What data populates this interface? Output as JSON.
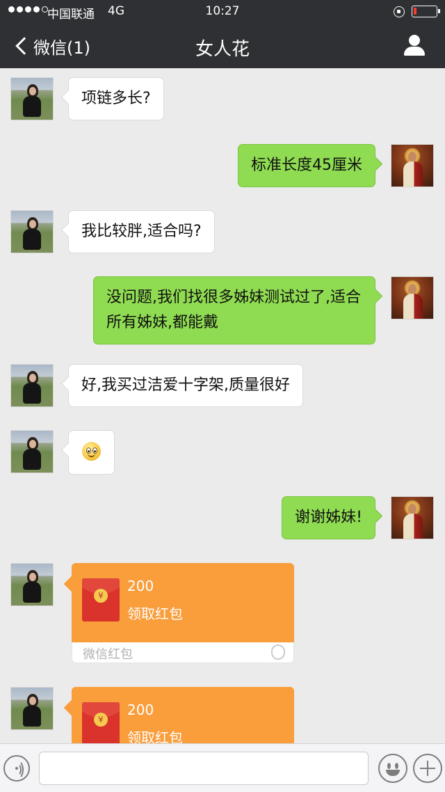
{
  "status_bar": {
    "carrier": "中国联通",
    "network": "4G",
    "time": "10:27"
  },
  "nav": {
    "back_label": "微信(1)",
    "title": "女人花"
  },
  "messages": [
    {
      "side": "left",
      "text": "项链多长?"
    },
    {
      "side": "right",
      "text": "标准长度45厘米"
    },
    {
      "side": "left",
      "text": "我比较胖,适合吗?"
    },
    {
      "side": "right",
      "text": "没问题,我们找很多姊妹测试过了,适合所有姊妹,都能戴"
    },
    {
      "side": "left",
      "text": "好,我买过洁爱十字架,质量很好"
    },
    {
      "side": "left",
      "emoji": "smile-emoji"
    },
    {
      "side": "right",
      "text": "谢谢姊妹!"
    }
  ],
  "red_packets": [
    {
      "amount": "200",
      "action": "领取红包",
      "source": "微信红包"
    },
    {
      "amount": "200",
      "action": "领取红包"
    }
  ],
  "input_bar": {
    "placeholder": ""
  },
  "colors": {
    "nav_bg": "#2e3033",
    "bubble_green": "#8fdc52",
    "bubble_white": "#ffffff",
    "red_packet": "#fa9d3b",
    "chat_bg": "#ebebeb"
  },
  "icons": [
    "back-chevron-icon",
    "profile-icon",
    "voice-icon",
    "emoji-face-icon",
    "plus-icon",
    "red-envelope-icon",
    "lock-rotation-icon",
    "battery-icon"
  ]
}
